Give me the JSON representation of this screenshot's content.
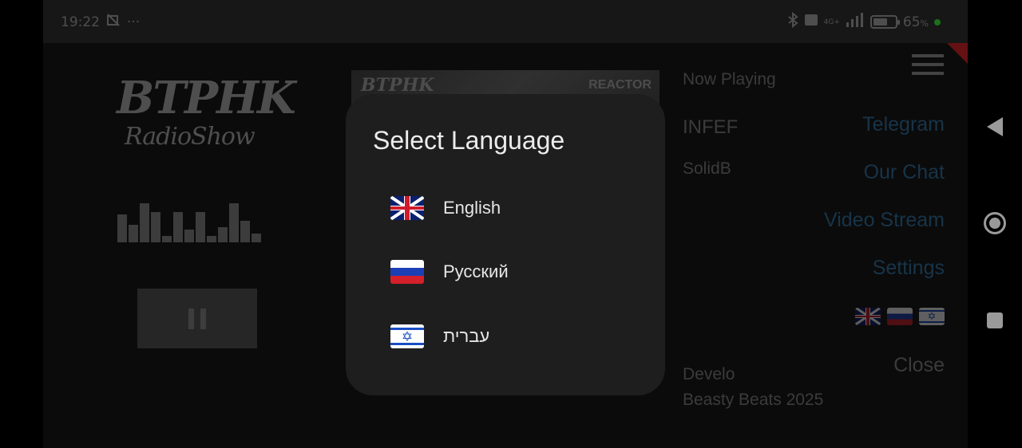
{
  "status_bar": {
    "time": "19:22",
    "left_icons": [
      "image-off-icon",
      "more-dots-icon"
    ],
    "more": "···",
    "network": "4G+",
    "battery_percent": "65",
    "battery_unit": "%",
    "battery_level": 0.65,
    "right_icons": [
      "bluetooth-icon",
      "hd-icon",
      "signal-icon",
      "battery-icon",
      "green-dot-icon"
    ]
  },
  "player": {
    "logo_main": "BTPHK",
    "logo_sub": "RadioShow",
    "equalizer_levels": [
      0.65,
      0.4,
      0.9,
      0.7,
      0.15,
      0.7,
      0.3,
      0.7,
      0.15,
      0.35,
      0.9,
      0.5,
      0.2
    ],
    "pause_icon": "pause-icon"
  },
  "cover": {
    "left_text": "BTPHK",
    "right_text": "REACTOR"
  },
  "info": {
    "now_playing_label": "Now Playing",
    "track_title": "INFEF",
    "track_artist": "SolidB",
    "developer_label": "Develo",
    "copyright": "Beasty Beats 2025"
  },
  "menu": {
    "icon": "hamburger-icon",
    "items": [
      "Telegram",
      "Our Chat",
      "Video Stream",
      "Settings"
    ],
    "flags": [
      "uk-flag-icon",
      "russia-flag-icon",
      "israel-flag-icon"
    ],
    "close_label": "Close",
    "accent_color": "#2b5f86"
  },
  "dialog": {
    "title": "Select Language",
    "options": [
      {
        "label": "English",
        "flag": "uk-flag-icon"
      },
      {
        "label": "Русский",
        "flag": "russia-flag-icon"
      },
      {
        "label": "עברית",
        "flag": "israel-flag-icon"
      }
    ]
  },
  "nav_bar": {
    "icons": [
      "back-icon",
      "home-icon",
      "recents-icon"
    ]
  }
}
